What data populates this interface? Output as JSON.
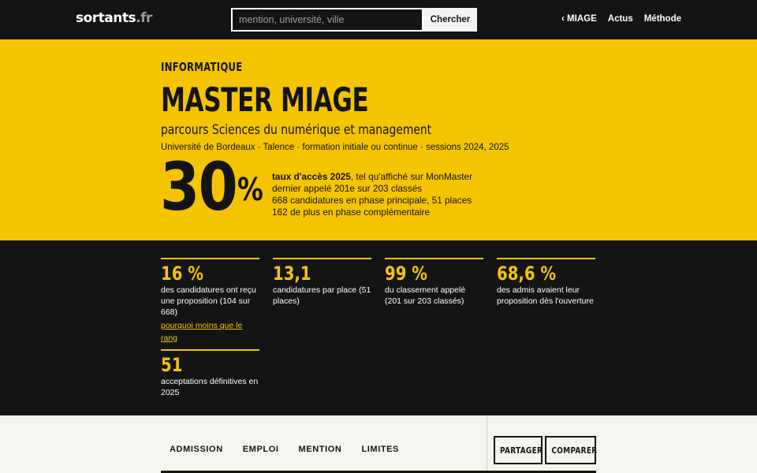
{
  "header": {
    "logo_main": "sortants",
    "logo_tld": ".fr",
    "search_placeholder": "mention, université, ville",
    "search_button": "Chercher",
    "nav": [
      "‹ MIAGE",
      "Actus",
      "Méthode"
    ]
  },
  "hero": {
    "kicker": "INFORMATIQUE",
    "title": "MASTER MIAGE",
    "subtitle": "parcours Sciences du numérique et management",
    "meta": "Université de Bordeaux · Talence · formation initiale ou continue · sessions 2024, 2025",
    "big_value": "30",
    "big_unit": "%",
    "line1_bold": "taux d'accès 2025",
    "line1_rest": ", tel qu'affiché sur MonMaster",
    "line2": "dernier appelé 201e sur 203 classés",
    "line3": "668 candidatures en phase principale, 51 places",
    "line4": "162 de plus en phase complémentaire"
  },
  "stats": [
    {
      "value": "16 %",
      "desc": "des candidatures ont reçu une proposition (104 sur 668)",
      "link": "pourquoi moins que le rang"
    },
    {
      "value": "13,1",
      "desc": "candidatures par place (51 places)"
    },
    {
      "value": "99 %",
      "desc": "du classement appelé (201 sur 203 classés)"
    },
    {
      "value": "68,6 %",
      "desc": "des admis avaient leur proposition dès l'ouverture"
    },
    {
      "value": "51",
      "desc": "acceptations définitives en 2025"
    }
  ],
  "tabs": [
    "ADMISSION",
    "EMPLOI",
    "MENTION",
    "LIMITES"
  ],
  "actions": {
    "share": "PARTAGER",
    "compare": "COMPARER"
  },
  "colors": {
    "accent": "#f5c400",
    "dark": "#141414",
    "light": "#f6f4ee"
  }
}
